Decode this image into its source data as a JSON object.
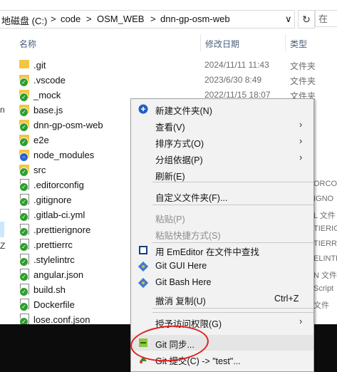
{
  "address": {
    "segments": [
      "地磁盘 (C:)",
      "code",
      "OSM_WEB",
      "dnn-gp-osm-web"
    ],
    "separator": ">",
    "dropdown_glyph": "∨",
    "refresh_glyph": "↻",
    "search_partial": "在"
  },
  "columns": {
    "name": "名称",
    "date": "修改日期",
    "type": "类型"
  },
  "nav_cutoff": {
    "n": "n",
    "z": "Z"
  },
  "files": [
    {
      "name": ".git",
      "date": "2024/11/11 11:43",
      "type": "文件夹",
      "icon": "folder",
      "badge": "none"
    },
    {
      "name": ".vscode",
      "date": "2023/6/30 8:49",
      "type": "文件夹",
      "icon": "folder",
      "badge": "green-check"
    },
    {
      "name": "_mock",
      "date": "2022/11/15 18:07",
      "type": "文件夹",
      "icon": "folder",
      "badge": "green-check"
    },
    {
      "name": "base.js",
      "date": "",
      "type": "",
      "icon": "folder",
      "badge": "green-check"
    },
    {
      "name": "dnn-gp-osm-web",
      "date": "",
      "type": "",
      "icon": "folder",
      "badge": "green-check"
    },
    {
      "name": "e2e",
      "date": "",
      "type": "",
      "icon": "folder",
      "badge": "green-check"
    },
    {
      "name": "node_modules",
      "date": "",
      "type": "",
      "icon": "folder",
      "badge": "blue-minus"
    },
    {
      "name": "src",
      "date": "",
      "type": "",
      "icon": "folder",
      "badge": "green-check"
    },
    {
      "name": ".editorconfig",
      "date": "",
      "type": "",
      "tail": "ORCON",
      "icon": "file",
      "badge": "green-check"
    },
    {
      "name": ".gitignore",
      "date": "",
      "type": "",
      "tail": "IGNO",
      "icon": "file",
      "badge": "green-check"
    },
    {
      "name": ".gitlab-ci.yml",
      "date": "",
      "type": "",
      "tail": "L 文件",
      "icon": "file",
      "badge": "green-check"
    },
    {
      "name": ".prettierignore",
      "date": "",
      "type": "",
      "tail": "TIERIG",
      "icon": "file",
      "badge": "green-check"
    },
    {
      "name": ".prettierrc",
      "date": "",
      "type": "",
      "tail": "TIERR",
      "icon": "file",
      "badge": "green-check"
    },
    {
      "name": ".stylelintrc",
      "date": "",
      "type": "",
      "tail": "ELINTR",
      "icon": "file",
      "badge": "green-check"
    },
    {
      "name": "angular.json",
      "date": "",
      "type": "",
      "tail": "N 文件",
      "icon": "file",
      "badge": "green-check"
    },
    {
      "name": "build.sh",
      "date": "",
      "type": "",
      "tail": "Script",
      "icon": "file",
      "badge": "green-check"
    },
    {
      "name": "Dockerfile",
      "date": "",
      "type": "",
      "tail": "文件",
      "icon": "file",
      "badge": "green-check"
    },
    {
      "name": "lose.conf.json",
      "date": "",
      "type": "",
      "tail": "",
      "icon": "file",
      "badge": "green-check"
    }
  ],
  "menu": {
    "items": [
      {
        "label": "新建文件夹(N)",
        "icon": "new-folder-icon",
        "shortcut": "",
        "arrow": false,
        "disabled": false
      },
      {
        "label": "查看(V)",
        "icon": "",
        "shortcut": "",
        "arrow": true,
        "disabled": false
      },
      {
        "label": "排序方式(O)",
        "icon": "",
        "shortcut": "",
        "arrow": true,
        "disabled": false
      },
      {
        "label": "分组依据(P)",
        "icon": "",
        "shortcut": "",
        "arrow": true,
        "disabled": false
      },
      {
        "label": "刷新(E)",
        "icon": "",
        "shortcut": "",
        "arrow": false,
        "disabled": false
      },
      {
        "label": "自定义文件夹(F)...",
        "icon": "",
        "shortcut": "",
        "arrow": false,
        "disabled": false
      },
      {
        "label": "粘贴(P)",
        "icon": "",
        "shortcut": "",
        "arrow": false,
        "disabled": true
      },
      {
        "label": "粘贴快捷方式(S)",
        "icon": "",
        "shortcut": "",
        "arrow": false,
        "disabled": true
      },
      {
        "label": "用 EmEditor 在文件中查找",
        "icon": "emeditor-icon",
        "shortcut": "",
        "arrow": false,
        "disabled": false
      },
      {
        "label": "Git GUI Here",
        "icon": "git-icon",
        "shortcut": "",
        "arrow": false,
        "disabled": false
      },
      {
        "label": "Git Bash Here",
        "icon": "git-icon",
        "shortcut": "",
        "arrow": false,
        "disabled": false
      },
      {
        "label": "撤消 复制(U)",
        "icon": "",
        "shortcut": "Ctrl+Z",
        "arrow": false,
        "disabled": false
      },
      {
        "label": "授予访问权限(G)",
        "icon": "",
        "shortcut": "",
        "arrow": true,
        "disabled": false
      },
      {
        "label": "Git 同步...",
        "icon": "tortoisegit-sync-icon",
        "shortcut": "",
        "arrow": false,
        "disabled": false
      },
      {
        "label": "Git 提交(C) -> \"test\"...",
        "icon": "tortoisegit-commit-icon",
        "shortcut": "",
        "arrow": false,
        "disabled": false
      }
    ]
  },
  "colors": {
    "check_badge": "#2e9e2e",
    "minus_badge": "#2a62c9",
    "folder": "#f4c542",
    "highlight_circle": "#e02020",
    "menu_bg": "#f2f2f2"
  }
}
